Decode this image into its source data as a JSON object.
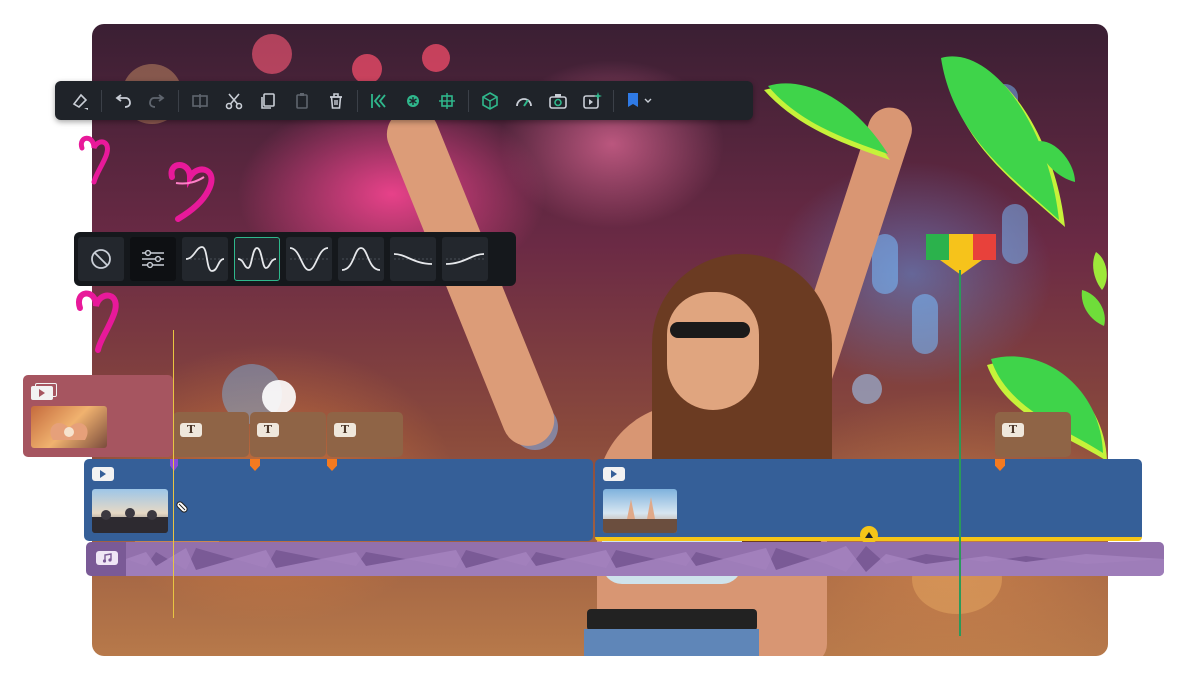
{
  "toolbar": {
    "buttons": [
      {
        "name": "erase-icon"
      },
      {
        "name": "undo-icon"
      },
      {
        "name": "redo-icon"
      },
      {
        "name": "split-icon"
      },
      {
        "name": "cut-icon"
      },
      {
        "name": "copy-icon"
      },
      {
        "name": "paste-icon"
      },
      {
        "name": "delete-icon"
      },
      {
        "name": "trim-icon"
      },
      {
        "name": "freeze-icon"
      },
      {
        "name": "crop-icon"
      },
      {
        "name": "3d-icon"
      },
      {
        "name": "speed-icon"
      },
      {
        "name": "snapshot-icon"
      },
      {
        "name": "ai-effect-icon"
      },
      {
        "name": "marker-icon"
      }
    ],
    "accent": "#2fb88c",
    "marker_color": "#2f7ae5"
  },
  "effects": {
    "items": [
      "none-icon",
      "adjust-icon",
      "curve-s-icon",
      "curve-bell-icon",
      "curve-dip-icon",
      "curve-peak-icon",
      "curve-fall-icon",
      "curve-rise-icon"
    ],
    "selected_index": 3
  },
  "timeline": {
    "text_badge": "T",
    "colors": {
      "overlay_clip": "#a65560",
      "title_clip": "#8f6446",
      "video_track": "#355f98",
      "audio_track": "#7a5a96",
      "playhead": "#2a9a5a",
      "keyframe": "#f47a20",
      "selection": "#f5c518"
    }
  },
  "colors": {
    "heart": "#e8199a",
    "leaf_green": "#3fd44a",
    "leaf_lime": "#c6f23a",
    "flag_green": "#2bb24c",
    "flag_yellow": "#f6c31b",
    "flag_red": "#e8413b"
  }
}
